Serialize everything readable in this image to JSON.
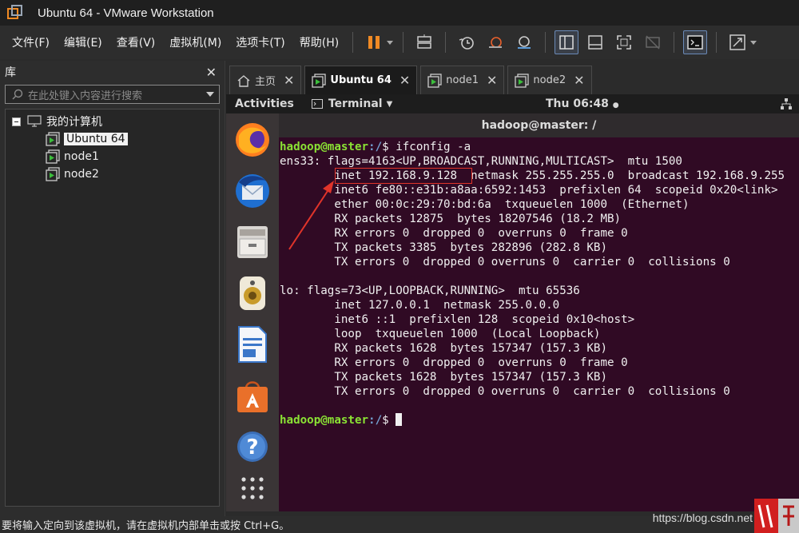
{
  "window": {
    "title": "Ubuntu 64 - VMware Workstation"
  },
  "menu": {
    "items": [
      "文件(F)",
      "编辑(E)",
      "查看(V)",
      "虚拟机(M)",
      "选项卡(T)",
      "帮助(H)"
    ]
  },
  "library": {
    "title": "库",
    "search_placeholder": "在此处键入内容进行搜索",
    "root_label": "我的计算机",
    "vms": [
      "Ubuntu 64",
      "node1",
      "node2"
    ]
  },
  "tabs": [
    {
      "label": "主页",
      "active": false
    },
    {
      "label": "Ubuntu 64",
      "active": true
    },
    {
      "label": "node1",
      "active": false
    },
    {
      "label": "node2",
      "active": false
    }
  ],
  "ubuntu_bar": {
    "activities": "Activities",
    "app": "Terminal",
    "clock": "Thu 06:48"
  },
  "terminal": {
    "title": "hadoop@master: /",
    "prompt_user": "hadoop@master",
    "prompt_path": ":/",
    "command": "$ ifconfig -a",
    "output": [
      "ens33: flags=4163<UP,BROADCAST,RUNNING,MULTICAST>  mtu 1500",
      "        inet 192.168.9.128  netmask 255.255.255.0  broadcast 192.168.9.255",
      "        inet6 fe80::e31b:a8aa:6592:1453  prefixlen 64  scopeid 0x20<link>",
      "        ether 00:0c:29:70:bd:6a  txqueuelen 1000  (Ethernet)",
      "        RX packets 12875  bytes 18207546 (18.2 MB)",
      "        RX errors 0  dropped 0  overruns 0  frame 0",
      "        TX packets 3385  bytes 282896 (282.8 KB)",
      "        TX errors 0  dropped 0 overruns 0  carrier 0  collisions 0",
      "",
      "lo: flags=73<UP,LOOPBACK,RUNNING>  mtu 65536",
      "        inet 127.0.0.1  netmask 255.0.0.0",
      "        inet6 ::1  prefixlen 128  scopeid 0x10<host>",
      "        loop  txqueuelen 1000  (Local Loopback)",
      "        RX packets 1628  bytes 157347 (157.3 KB)",
      "        RX errors 0  dropped 0  overruns 0  frame 0",
      "        TX packets 1628  bytes 157347 (157.3 KB)",
      "        TX errors 0  dropped 0 overruns 0  carrier 0  collisions 0",
      ""
    ],
    "final_prompt": "$ "
  },
  "statusbar": {
    "text": "要将输入定向到该虚拟机，请在虚拟机内部单击或按 Ctrl+G。"
  },
  "watermark": {
    "text": "https://blog.csdn.net"
  },
  "colors": {
    "terminal_bg": "#300a24",
    "prompt_green": "#8ae234",
    "prompt_blue": "#729fcf",
    "annotation_red": "#e0342a",
    "pause_orange": "#f08a24"
  }
}
